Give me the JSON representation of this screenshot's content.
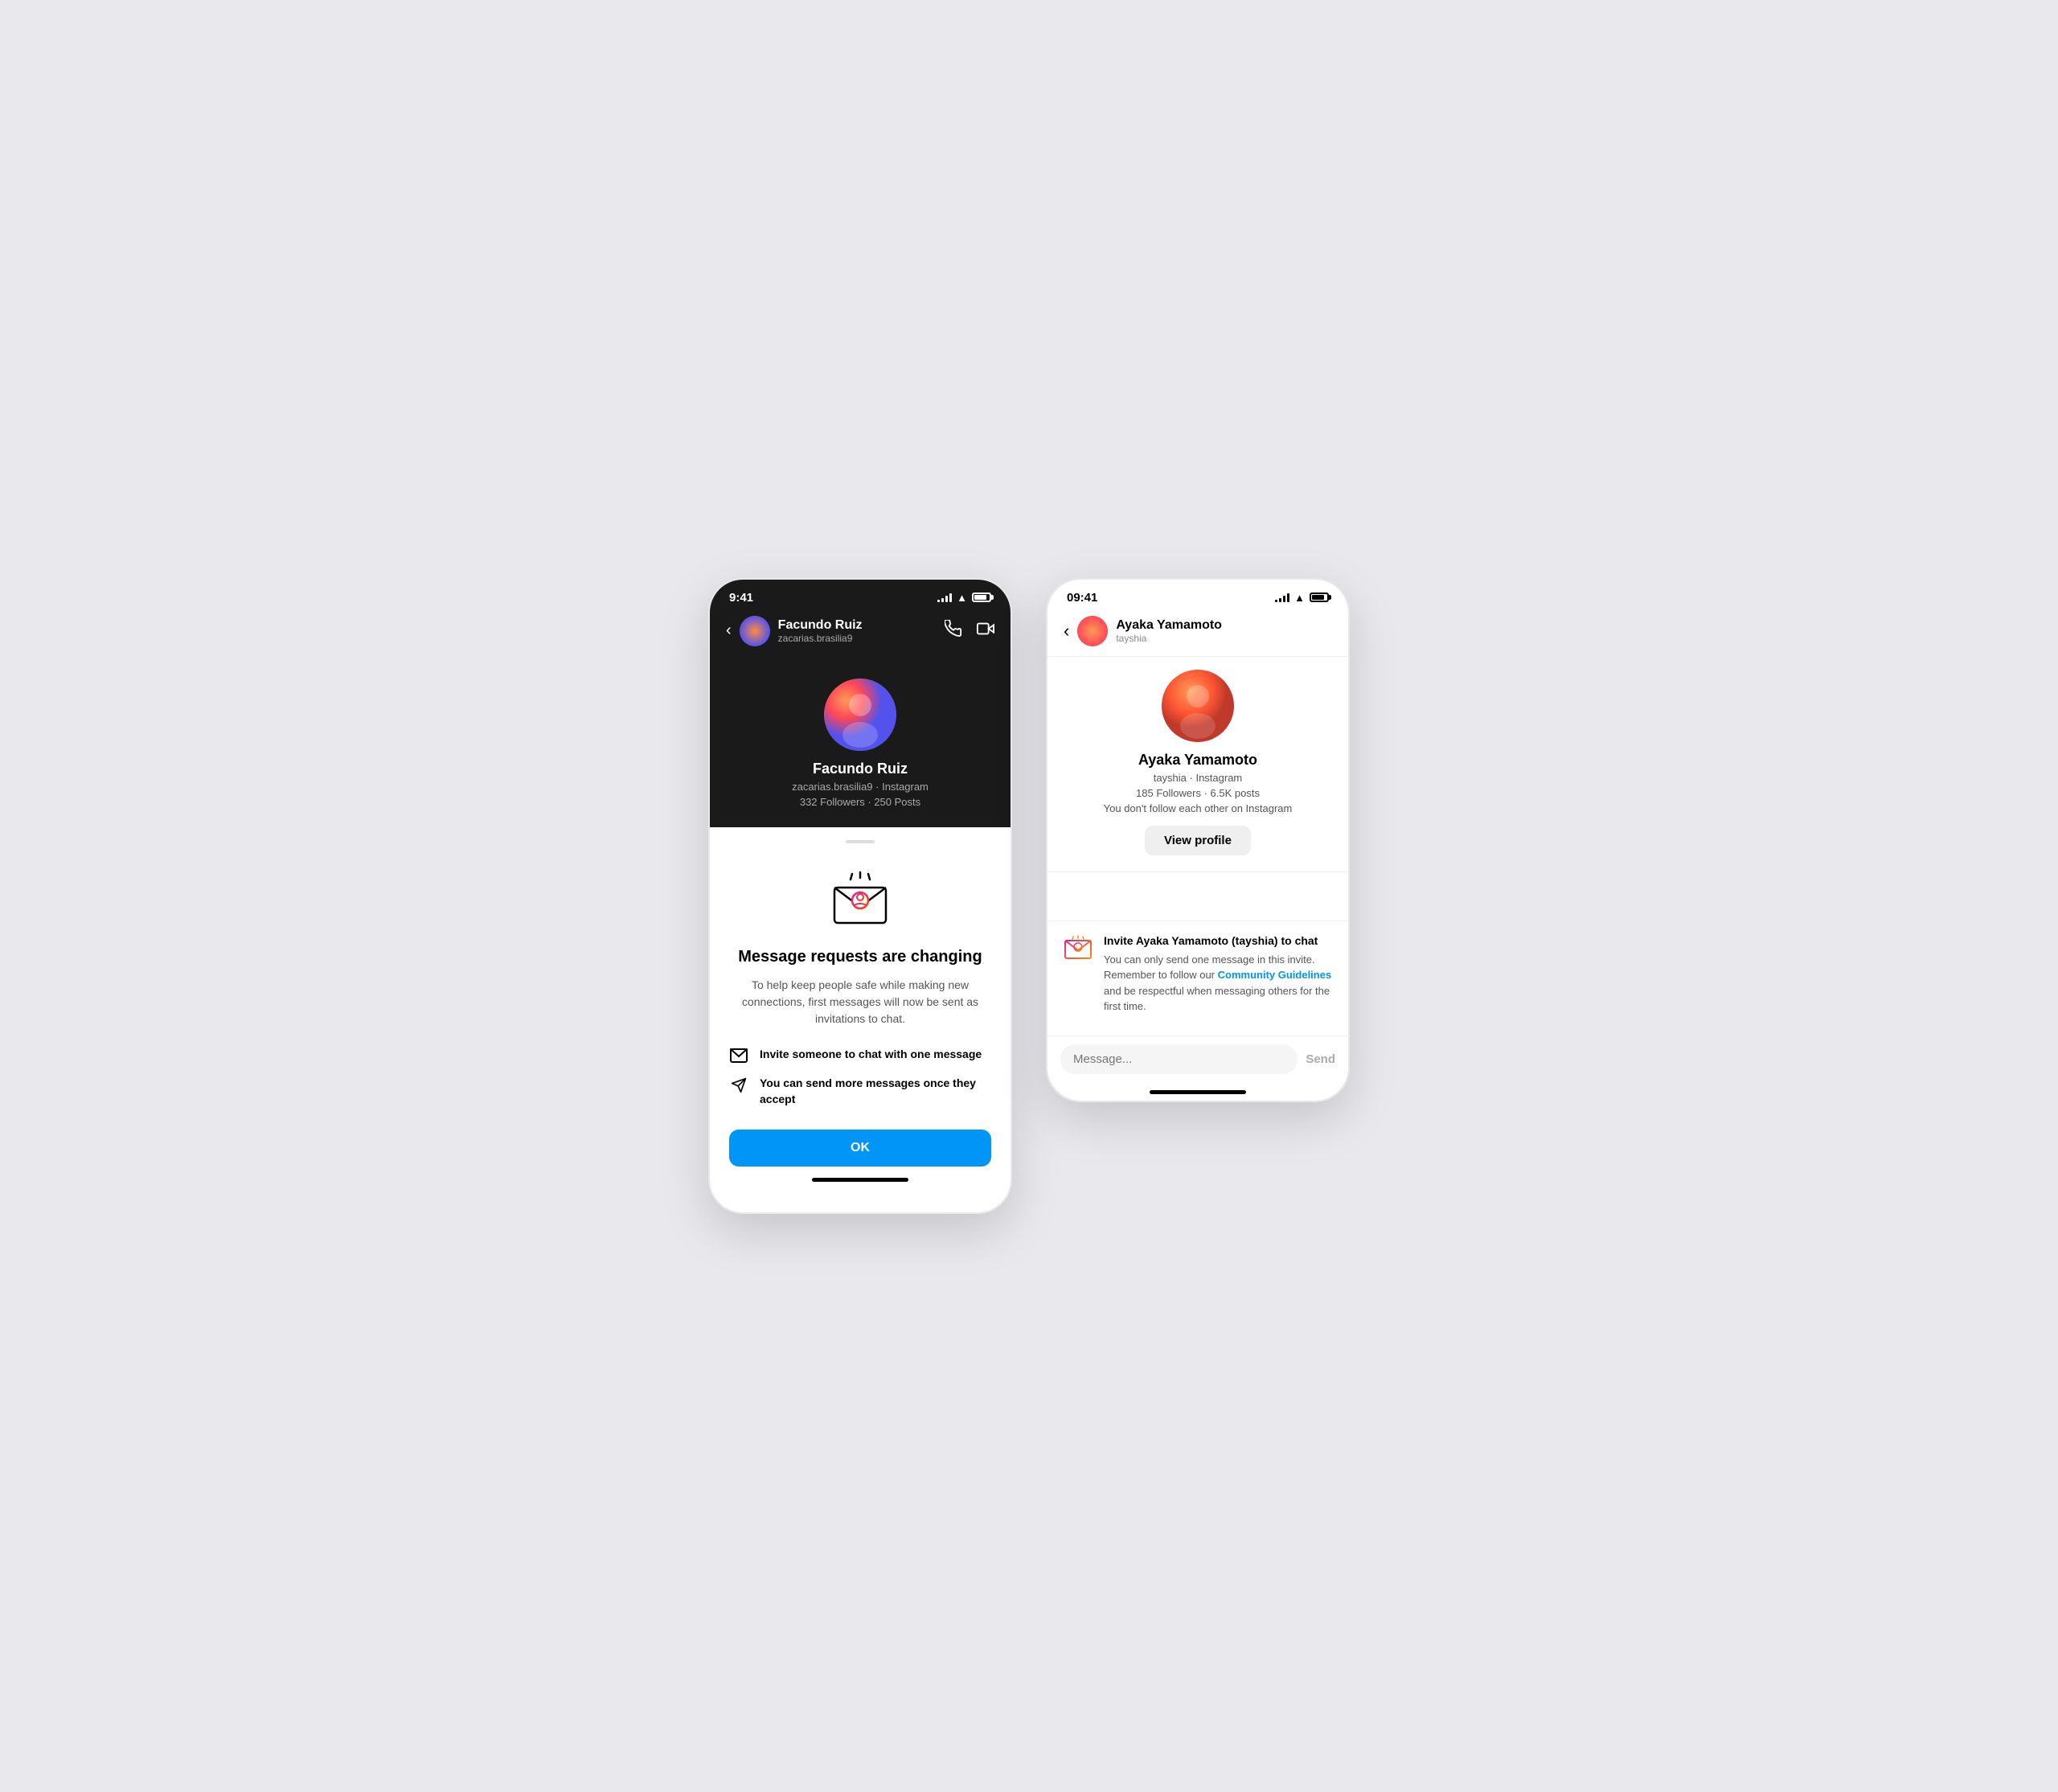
{
  "left_phone": {
    "status_bar": {
      "time": "9:41",
      "signal_bars": 4,
      "wifi": true,
      "battery": true
    },
    "header": {
      "user_name": "Facundo Ruiz",
      "username": "zacarias.brasilia9",
      "back_label": "‹",
      "phone_icon": "phone",
      "video_icon": "video"
    },
    "profile": {
      "name": "Facundo Ruiz",
      "meta": "zacarias.brasilia9 · Instagram",
      "stats": "332 Followers · 250 Posts"
    },
    "bottom_sheet": {
      "title": "Message requests are changing",
      "description": "To help keep people safe while making new connections, first messages will now be sent as invitations to chat.",
      "features": [
        {
          "icon": "envelope",
          "text": "Invite someone to chat with one message"
        },
        {
          "icon": "send",
          "text": "You can send more messages once they accept"
        }
      ],
      "ok_button": "OK"
    }
  },
  "right_phone": {
    "status_bar": {
      "time": "09:41",
      "signal_bars": 4,
      "wifi": true,
      "battery": true
    },
    "header": {
      "user_name": "Ayaka Yamamoto",
      "username": "tayshia",
      "back_label": "‹"
    },
    "profile": {
      "name": "Ayaka Yamamoto",
      "meta": "tayshia · Instagram",
      "stats": "185 Followers · 6.5K posts",
      "follow_info": "You don't follow each other on Instagram",
      "view_profile_btn": "View profile"
    },
    "invite_section": {
      "title": "Invite Ayaka Yamamoto (tayshia) to chat",
      "description": "You can only send one message in this invite. Remember to follow our ",
      "community_link": "Community Guidelines",
      "description_end": " and be respectful when messaging others for the first time."
    },
    "message_bar": {
      "placeholder": "Message...",
      "send_label": "Send"
    }
  }
}
